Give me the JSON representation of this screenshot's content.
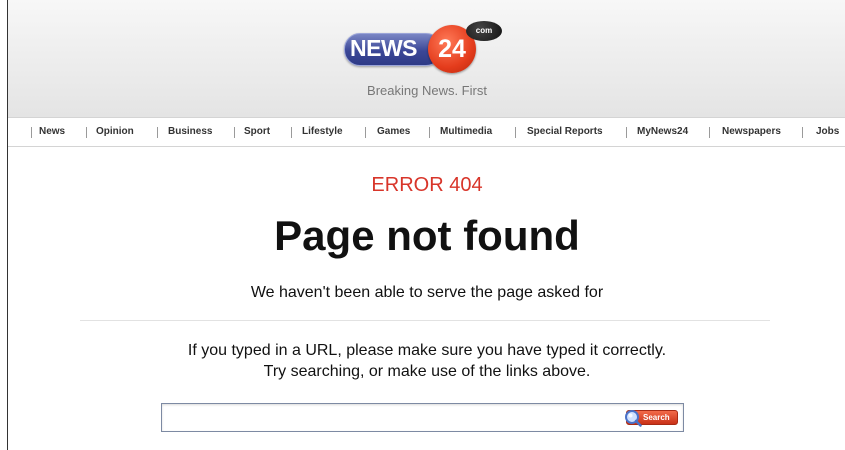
{
  "header": {
    "logo": {
      "word": "NEWS",
      "number": "24",
      "suffix": "com"
    },
    "tagline": "Breaking News. First"
  },
  "nav": {
    "items": [
      {
        "label": "News"
      },
      {
        "label": "Opinion"
      },
      {
        "label": "Business"
      },
      {
        "label": "Sport"
      },
      {
        "label": "Lifestyle"
      },
      {
        "label": "Games"
      },
      {
        "label": "Multimedia"
      },
      {
        "label": "Special Reports"
      },
      {
        "label": "MyNews24"
      },
      {
        "label": "Newspapers"
      },
      {
        "label": "Jobs"
      }
    ]
  },
  "main": {
    "error_code": "ERROR 404",
    "headline": "Page not found",
    "subline": "We haven't been able to serve the page asked for",
    "help_line1": "If you typed in a URL, please make sure you have typed it correctly.",
    "help_line2": "Try searching, or make use of the links above."
  },
  "search": {
    "value": "",
    "button_label": "Search",
    "icon": "magnifier-icon"
  },
  "colors": {
    "error_red": "#d8352a",
    "logo_blue": "#3b4797",
    "logo_red": "#e43c1c",
    "search_button_red": "#c93218"
  }
}
